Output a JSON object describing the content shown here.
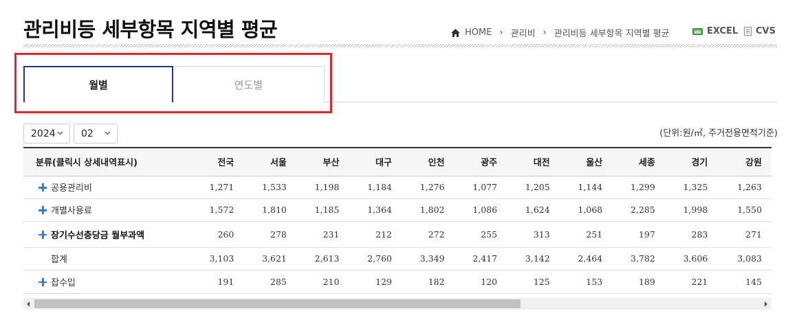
{
  "page": {
    "title": "관리비등 세부항목 지역별 평균"
  },
  "breadcrumb": {
    "home": "HOME",
    "level1": "관리비",
    "level2": "관리비등 세부항목 지역별 평균"
  },
  "export": {
    "excel": "EXCEL",
    "cvs": "CVS"
  },
  "tabs": [
    {
      "label": "월별",
      "active": true
    },
    {
      "label": "연도별",
      "active": false
    }
  ],
  "filters": {
    "year": "2024",
    "month": "02"
  },
  "unit_note": "(단위:원/㎡, 주거전용면적기준)",
  "table": {
    "headers": [
      "분류(클릭시 상세내역표시)",
      "전국",
      "서울",
      "부산",
      "대구",
      "인천",
      "광주",
      "대전",
      "울산",
      "세종",
      "경기",
      "강원"
    ],
    "rows": [
      {
        "label": "공용관리비",
        "expandable": true,
        "bold": false,
        "values": [
          "1,271",
          "1,533",
          "1,198",
          "1,184",
          "1,276",
          "1,077",
          "1,205",
          "1,144",
          "1,299",
          "1,325",
          "1,263"
        ]
      },
      {
        "label": "개별사용료",
        "expandable": true,
        "bold": false,
        "values": [
          "1,572",
          "1,810",
          "1,185",
          "1,364",
          "1,802",
          "1,086",
          "1,624",
          "1,068",
          "2,285",
          "1,998",
          "1,550"
        ]
      },
      {
        "label": "장기수선충당금 월부과액",
        "expandable": true,
        "bold": true,
        "values": [
          "260",
          "278",
          "231",
          "212",
          "272",
          "255",
          "313",
          "251",
          "197",
          "283",
          "271"
        ]
      },
      {
        "label": "합계",
        "expandable": false,
        "bold": false,
        "values": [
          "3,103",
          "3,621",
          "2,613",
          "2,760",
          "3,349",
          "2,417",
          "3,142",
          "2,464",
          "3,782",
          "3,606",
          "3,083"
        ]
      },
      {
        "label": "잡수입",
        "expandable": true,
        "bold": false,
        "values": [
          "191",
          "285",
          "210",
          "129",
          "182",
          "120",
          "125",
          "153",
          "189",
          "221",
          "145"
        ]
      }
    ]
  },
  "icons": {
    "home": "home-icon",
    "excel": "excel-icon",
    "cvs": "document-icon",
    "select": "chevron-down-icon",
    "expand": "plus-icon"
  },
  "colors": {
    "active_tab_border": "#1e3a7a",
    "highlight_border": "#e3242b",
    "plus_icon": "#2a7fd3",
    "excel_icon": "#3a9a3a"
  }
}
